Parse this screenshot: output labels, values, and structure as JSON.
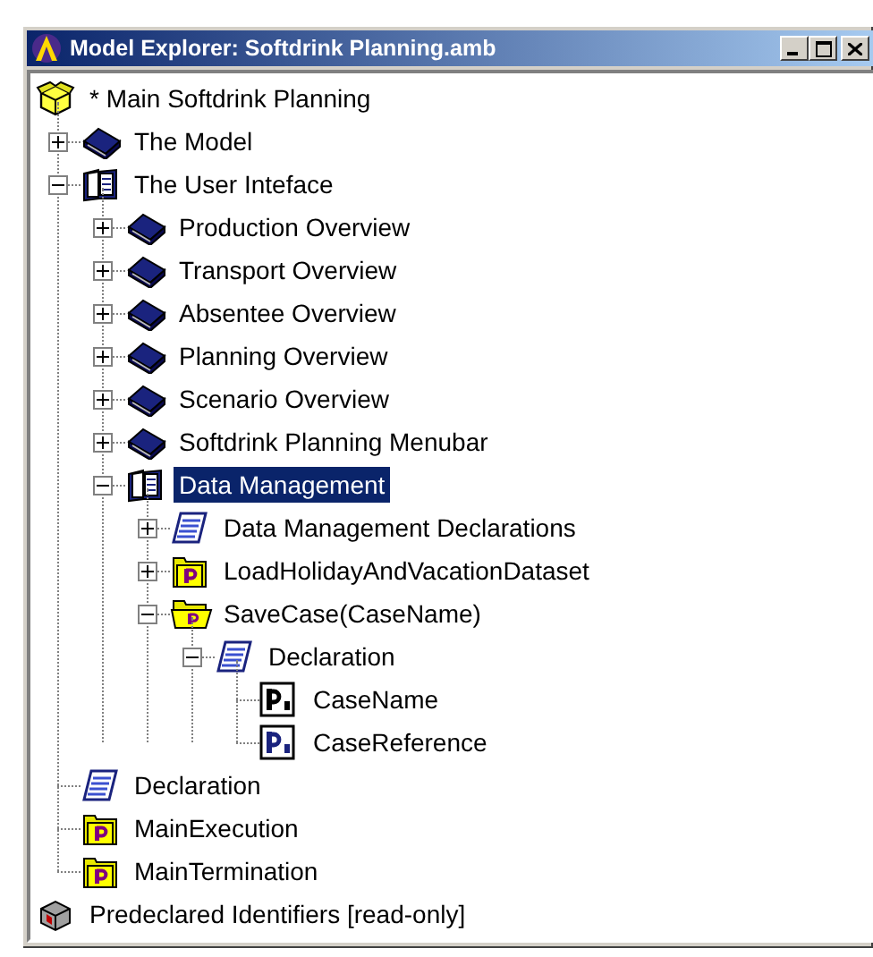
{
  "window": {
    "title": "Model Explorer: Softdrink Planning.amb"
  },
  "tree": [
    {
      "label": "* Main Softdrink Planning",
      "kind": "model",
      "selected": false,
      "children": [
        {
          "label": "The Model",
          "kind": "book",
          "expanded": false,
          "selected": false
        },
        {
          "label": "The User Inteface",
          "kind": "book-open",
          "expanded": true,
          "selected": false,
          "children": [
            {
              "label": "Production Overview",
              "kind": "book",
              "expanded": false,
              "selected": false
            },
            {
              "label": "Transport Overview",
              "kind": "book",
              "expanded": false,
              "selected": false
            },
            {
              "label": "Absentee Overview",
              "kind": "book",
              "expanded": false,
              "selected": false
            },
            {
              "label": "Planning Overview",
              "kind": "book",
              "expanded": false,
              "selected": false
            },
            {
              "label": "Scenario Overview",
              "kind": "book",
              "expanded": false,
              "selected": false
            },
            {
              "label": "Softdrink Planning Menubar",
              "kind": "book",
              "expanded": false,
              "selected": false
            },
            {
              "label": "Data Management",
              "kind": "book-open",
              "expanded": true,
              "selected": true,
              "children": [
                {
                  "label": "Data Management Declarations",
                  "kind": "script",
                  "expanded": false,
                  "selected": false
                },
                {
                  "label": "LoadHolidayAndVacationDataset",
                  "kind": "procedure",
                  "expanded": false,
                  "selected": false
                },
                {
                  "label": "SaveCase(CaseName)",
                  "kind": "procedure-open",
                  "expanded": true,
                  "selected": false,
                  "children": [
                    {
                      "label": "Declaration",
                      "kind": "script",
                      "expanded": true,
                      "selected": false,
                      "children": [
                        {
                          "label": "CaseName",
                          "kind": "param-string",
                          "selected": false
                        },
                        {
                          "label": "CaseReference",
                          "kind": "param-element",
                          "selected": false
                        }
                      ]
                    }
                  ]
                }
              ]
            }
          ]
        },
        {
          "label": "Declaration",
          "kind": "script",
          "selected": false
        },
        {
          "label": "MainExecution",
          "kind": "procedure",
          "selected": false
        },
        {
          "label": "MainTermination",
          "kind": "procedure",
          "selected": false
        }
      ]
    },
    {
      "label": "Predeclared Identifiers [read-only]",
      "kind": "library",
      "selected": false
    }
  ]
}
